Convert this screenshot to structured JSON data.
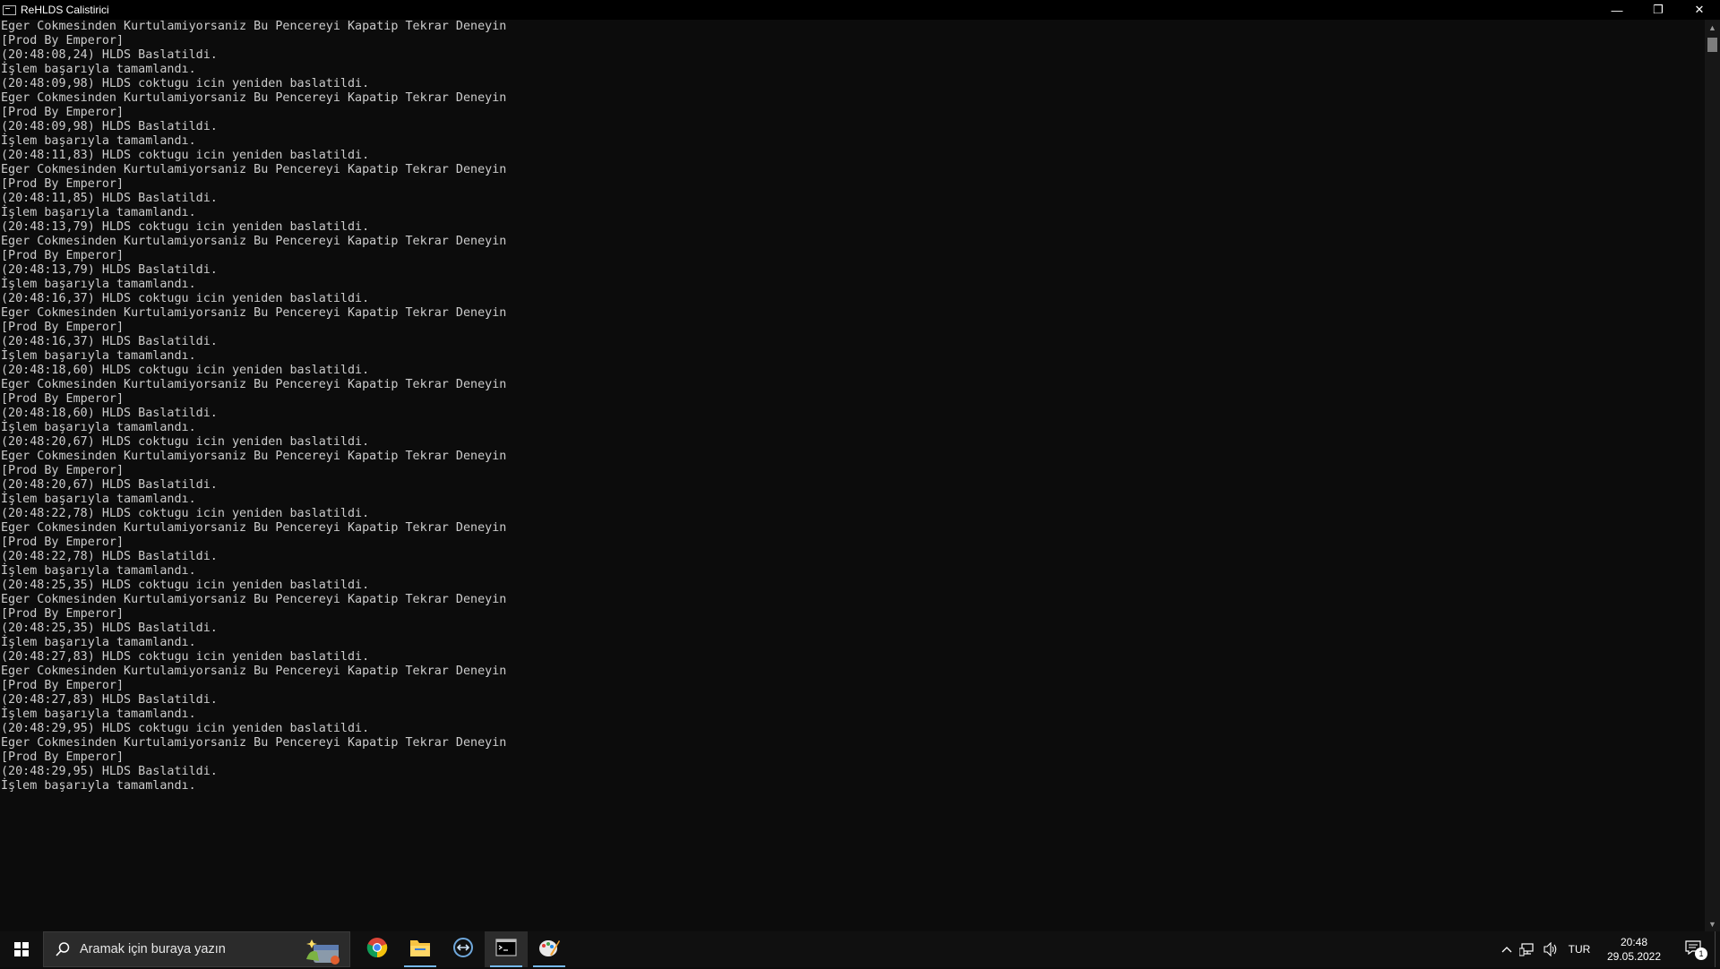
{
  "window": {
    "title": "ReHLDS Calistirici",
    "controls": {
      "minimize": "—",
      "restore": "❐",
      "close": "✕"
    }
  },
  "console_lines": [
    "Eger Cokmesinden Kurtulamiyorsaniz Bu Pencereyi Kapatip Tekrar Deneyin",
    "[Prod By Emperor]",
    "(20:48:08,24) HLDS Baslatildi.",
    "İşlem başarıyla tamamlandı.",
    "(20:48:09,98) HLDS coktugu icin yeniden baslatildi.",
    "Eger Cokmesinden Kurtulamiyorsaniz Bu Pencereyi Kapatip Tekrar Deneyin",
    "[Prod By Emperor]",
    "(20:48:09,98) HLDS Baslatildi.",
    "İşlem başarıyla tamamlandı.",
    "(20:48:11,83) HLDS coktugu icin yeniden baslatildi.",
    "Eger Cokmesinden Kurtulamiyorsaniz Bu Pencereyi Kapatip Tekrar Deneyin",
    "[Prod By Emperor]",
    "(20:48:11,85) HLDS Baslatildi.",
    "İşlem başarıyla tamamlandı.",
    "(20:48:13,79) HLDS coktugu icin yeniden baslatildi.",
    "Eger Cokmesinden Kurtulamiyorsaniz Bu Pencereyi Kapatip Tekrar Deneyin",
    "[Prod By Emperor]",
    "(20:48:13,79) HLDS Baslatildi.",
    "İşlem başarıyla tamamlandı.",
    "(20:48:16,37) HLDS coktugu icin yeniden baslatildi.",
    "Eger Cokmesinden Kurtulamiyorsaniz Bu Pencereyi Kapatip Tekrar Deneyin",
    "[Prod By Emperor]",
    "(20:48:16,37) HLDS Baslatildi.",
    "İşlem başarıyla tamamlandı.",
    "(20:48:18,60) HLDS coktugu icin yeniden baslatildi.",
    "Eger Cokmesinden Kurtulamiyorsaniz Bu Pencereyi Kapatip Tekrar Deneyin",
    "[Prod By Emperor]",
    "(20:48:18,60) HLDS Baslatildi.",
    "İşlem başarıyla tamamlandı.",
    "(20:48:20,67) HLDS coktugu icin yeniden baslatildi.",
    "Eger Cokmesinden Kurtulamiyorsaniz Bu Pencereyi Kapatip Tekrar Deneyin",
    "[Prod By Emperor]",
    "(20:48:20,67) HLDS Baslatildi.",
    "İşlem başarıyla tamamlandı.",
    "(20:48:22,78) HLDS coktugu icin yeniden baslatildi.",
    "Eger Cokmesinden Kurtulamiyorsaniz Bu Pencereyi Kapatip Tekrar Deneyin",
    "[Prod By Emperor]",
    "(20:48:22,78) HLDS Baslatildi.",
    "İşlem başarıyla tamamlandı.",
    "(20:48:25,35) HLDS coktugu icin yeniden baslatildi.",
    "Eger Cokmesinden Kurtulamiyorsaniz Bu Pencereyi Kapatip Tekrar Deneyin",
    "[Prod By Emperor]",
    "(20:48:25,35) HLDS Baslatildi.",
    "İşlem başarıyla tamamlandı.",
    "(20:48:27,83) HLDS coktugu icin yeniden baslatildi.",
    "Eger Cokmesinden Kurtulamiyorsaniz Bu Pencereyi Kapatip Tekrar Deneyin",
    "[Prod By Emperor]",
    "(20:48:27,83) HLDS Baslatildi.",
    "İşlem başarıyla tamamlandı.",
    "(20:48:29,95) HLDS coktugu icin yeniden baslatildi.",
    "Eger Cokmesinden Kurtulamiyorsaniz Bu Pencereyi Kapatip Tekrar Deneyin",
    "[Prod By Emperor]",
    "(20:48:29,95) HLDS Baslatildi.",
    "İşlem başarıyla tamamlandı."
  ],
  "taskbar": {
    "search_placeholder": "Aramak için buraya yazın",
    "apps": [
      {
        "name": "chrome-icon",
        "state": "normal"
      },
      {
        "name": "file-explorer-icon",
        "state": "open"
      },
      {
        "name": "teamviewer-icon",
        "state": "normal"
      },
      {
        "name": "console-icon",
        "state": "active"
      },
      {
        "name": "paint-icon",
        "state": "open"
      }
    ],
    "tray": {
      "language": "TUR",
      "time": "20:48",
      "date": "29.05.2022",
      "notification_count": "1"
    }
  },
  "colors": {
    "console_bg": "#0c0c0c",
    "console_text": "#cccccc",
    "taskbar_bg": "#101010",
    "accent": "#76b9ed"
  }
}
